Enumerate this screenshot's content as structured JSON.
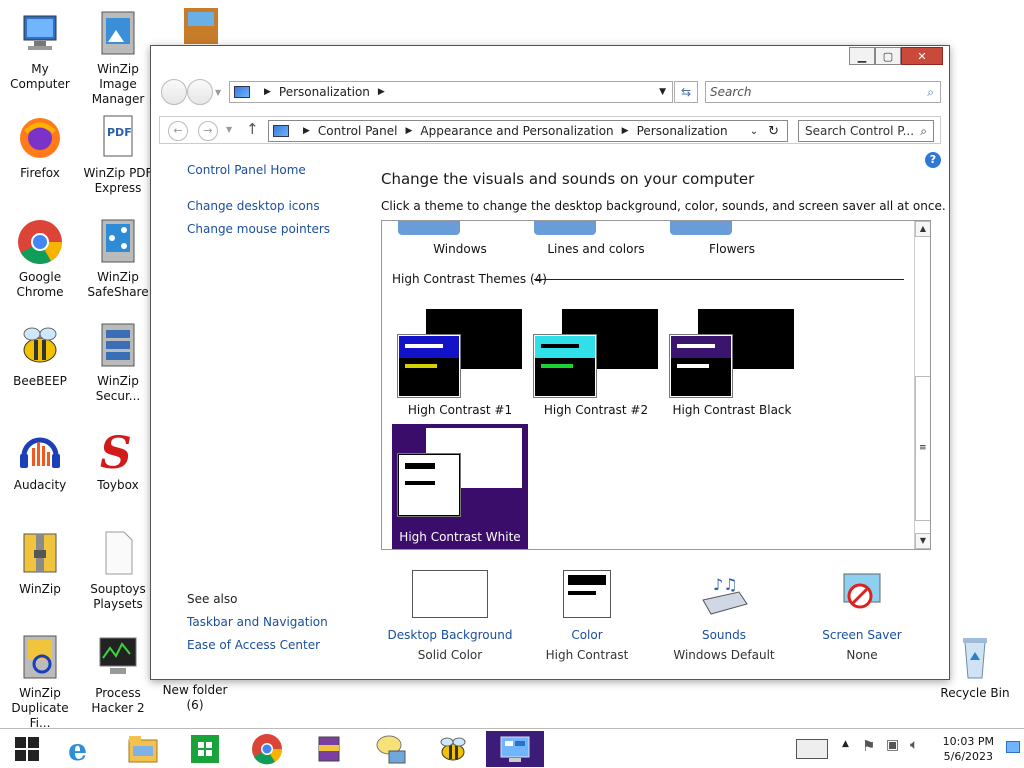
{
  "desktop": {
    "icons": [
      {
        "label": "My Computer"
      },
      {
        "label": "WinZip Image Manager"
      },
      {
        "label": "Firefox"
      },
      {
        "label": "WinZip PDF Express"
      },
      {
        "label": "Google Chrome"
      },
      {
        "label": "WinZip SafeShare"
      },
      {
        "label": "BeeBEEP"
      },
      {
        "label": "WinZip Secur..."
      },
      {
        "label": "Audacity"
      },
      {
        "label": "Toybox"
      },
      {
        "label": "WinZip"
      },
      {
        "label": "Souptoys Playsets"
      },
      {
        "label": "WinZip Duplicate Fi..."
      },
      {
        "label": "Process Hacker 2"
      },
      {
        "label": "New folder (6)"
      },
      {
        "label": "Recycle Bin"
      }
    ]
  },
  "window": {
    "caption": {
      "minimize": "▁",
      "maximize": "▢",
      "close": "✕"
    },
    "address1": "Personalization",
    "search1_placeholder": "Search",
    "breadcrumb": [
      "Control Panel",
      "Appearance and Personalization",
      "Personalization"
    ],
    "search2_placeholder": "Search Control P...",
    "help": "?"
  },
  "sidebar": {
    "home": "Control Panel Home",
    "links": [
      "Change desktop icons",
      "Change mouse pointers"
    ],
    "see_also": "See also",
    "see_also_links": [
      "Taskbar and Navigation",
      "Ease of Access Center"
    ]
  },
  "main": {
    "title": "Change the visuals and sounds on your computer",
    "subtitle": "Click a theme to change the desktop background, color, sounds, and screen saver all at once.",
    "top_themes": [
      "Windows",
      "Lines and colors",
      "Flowers"
    ],
    "group_label": "High Contrast Themes (4)",
    "hc_themes": [
      {
        "name": "High Contrast #1",
        "header": "#1212c8",
        "line2": "#d6d000"
      },
      {
        "name": "High Contrast #2",
        "header": "#2fe0e8",
        "line2": "#1bd233"
      },
      {
        "name": "High Contrast Black",
        "header": "#3b1470",
        "line2": "#ffffff"
      },
      {
        "name": "High Contrast White",
        "header": "#000000",
        "line2": "#000000"
      }
    ],
    "selected_color": "#3b0d6a"
  },
  "options": [
    {
      "label": "Desktop Background",
      "value": "Solid Color"
    },
    {
      "label": "Color",
      "value": "High Contrast"
    },
    {
      "label": "Sounds",
      "value": "Windows Default"
    },
    {
      "label": "Screen Saver",
      "value": "None"
    }
  ],
  "taskbar": {
    "apps": [
      "start-icon",
      "internet-explorer-icon",
      "file-explorer-icon",
      "store-icon",
      "chrome-icon",
      "winrar-icon",
      "messenger-icon",
      "beebeep-icon",
      "control-panel-icon"
    ],
    "time": "10:03 PM",
    "date": "5/6/2023"
  }
}
